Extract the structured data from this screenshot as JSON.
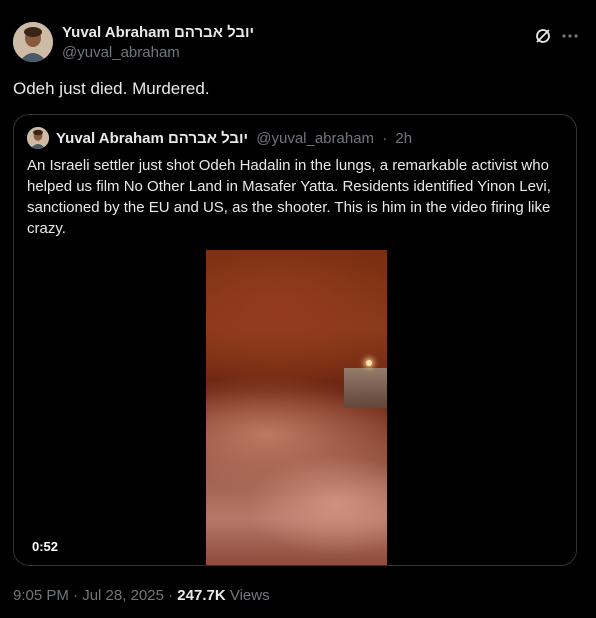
{
  "author": {
    "name": "Yuval Abraham יובל אברהם",
    "handle": "@yuval_abraham"
  },
  "tweet": {
    "text": "Odeh just died. Murdered."
  },
  "quoted": {
    "name": "Yuval Abraham יובל אברהם",
    "handle": "@yuval_abraham",
    "separator": "·",
    "age": "2h",
    "text": "An Israeli settler just shot Odeh Hadalin in the lungs, a remarkable activist who helped us film No Other Land in Masafer Yatta. Residents identified Yinon Levi, sanctioned by the EU and US, as the shooter. This is him in the video firing like crazy.",
    "video_duration": "0:52"
  },
  "footer": {
    "time": "9:05 PM",
    "dot1": "·",
    "date": "Jul 28, 2025",
    "dot2": "·",
    "views_count": "247.7K",
    "views_label": "Views"
  },
  "icons": {
    "header_right": [
      "grok-icon",
      "more-icon"
    ]
  }
}
